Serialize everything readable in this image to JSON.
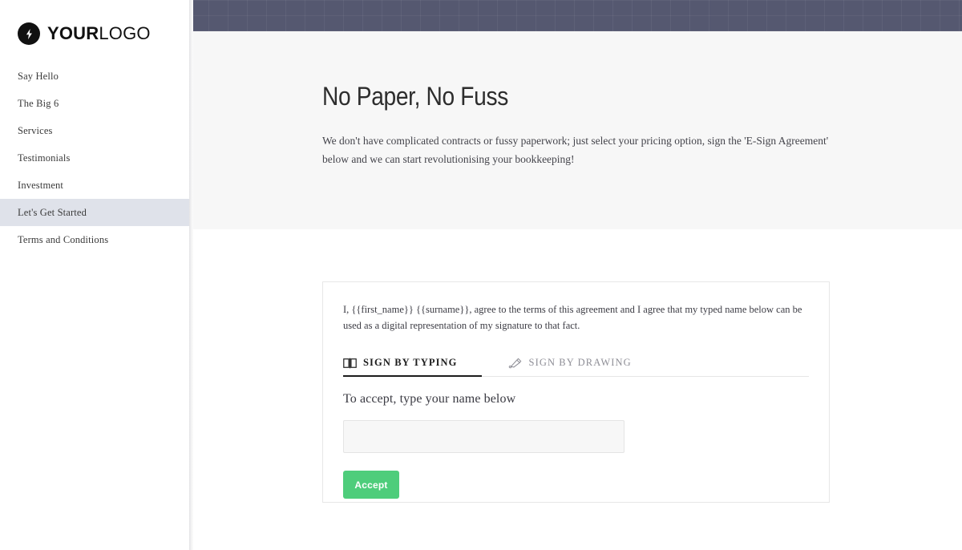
{
  "brand": {
    "logo_icon": "lightning-bolt-icon",
    "name_bold": "YOUR",
    "name_light": "LOGO"
  },
  "sidebar": {
    "items": [
      {
        "label": "Say Hello",
        "active": false
      },
      {
        "label": "The Big 6",
        "active": false
      },
      {
        "label": "Services",
        "active": false
      },
      {
        "label": "Testimonials",
        "active": false
      },
      {
        "label": "Investment",
        "active": false
      },
      {
        "label": "Let's Get Started",
        "active": true
      },
      {
        "label": "Terms and Conditions",
        "active": false
      }
    ]
  },
  "hero": {
    "title": "No Paper, No Fuss",
    "body": "We don't have complicated contracts or fussy paperwork; just select your pricing option, sign the 'E-Sign Agreement' below and we can start revolutionising your bookkeeping!"
  },
  "card": {
    "agreement_text": "I, {{first_name}} {{surname}}, agree to the terms of this agreement and I agree that my typed name below can be used as a digital representation of my signature to that fact.",
    "tabs": [
      {
        "label": "SIGN BY TYPING",
        "icon": "keyboard-typing-icon",
        "active": true
      },
      {
        "label": "SIGN BY DRAWING",
        "icon": "pen-quill-icon",
        "active": false
      }
    ],
    "accept_heading": "To accept, type your name below",
    "name_input": {
      "value": "",
      "placeholder": ""
    },
    "accept_button": "Accept"
  },
  "colors": {
    "topbar": "#555870",
    "hero_bg": "#f7f7f7",
    "sidebar_active": "#dfe2ea",
    "accept_green": "#4ecd7b",
    "card_border": "#e7e7e7"
  }
}
